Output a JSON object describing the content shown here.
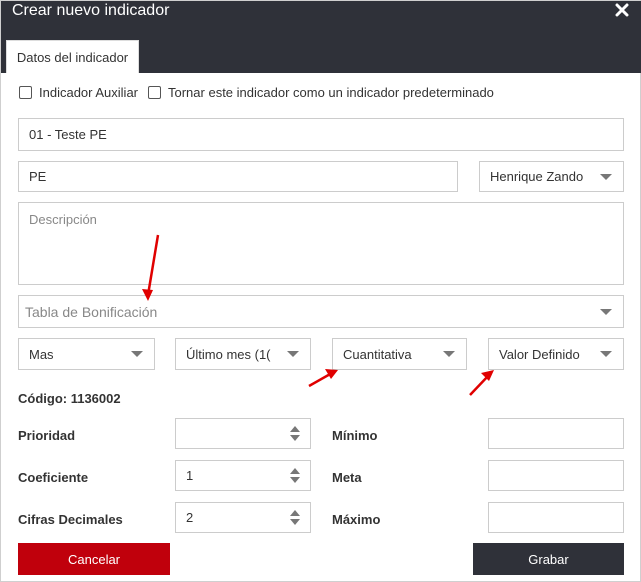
{
  "dialog": {
    "title": "Crear nuevo indicador",
    "tab_label": "Datos del indicador"
  },
  "checkboxes": [
    {
      "label": "Indicador Auxiliar",
      "checked": false
    },
    {
      "label": "Tornar este indicador como un indicador predeterminado",
      "checked": false
    }
  ],
  "fields": {
    "name": "01 - Teste PE",
    "short_name": "PE",
    "owner": "Henrique Zando",
    "description_placeholder": "Descripción",
    "bonus_table_placeholder": "Tabla de Bonificación",
    "direction": "Mas",
    "period": "Último mes (1(",
    "type": "Cuantitativa",
    "value_mode": "Valor Definido"
  },
  "code": {
    "text": "Código: 1136002"
  },
  "left_fields": [
    {
      "label": "Prioridad",
      "value": ""
    },
    {
      "label": "Coeficiente",
      "value": "1"
    },
    {
      "label": "Cifras Decimales",
      "value": "2"
    }
  ],
  "right_fields": [
    {
      "label": "Mínimo",
      "value": ""
    },
    {
      "label": "Meta",
      "value": ""
    },
    {
      "label": "Máximo",
      "value": ""
    }
  ],
  "buttons": {
    "cancel": "Cancelar",
    "save": "Grabar"
  },
  "colors": {
    "header": "#2f3139",
    "cancel": "#c0000c",
    "annotation_arrow": "#e00000"
  }
}
